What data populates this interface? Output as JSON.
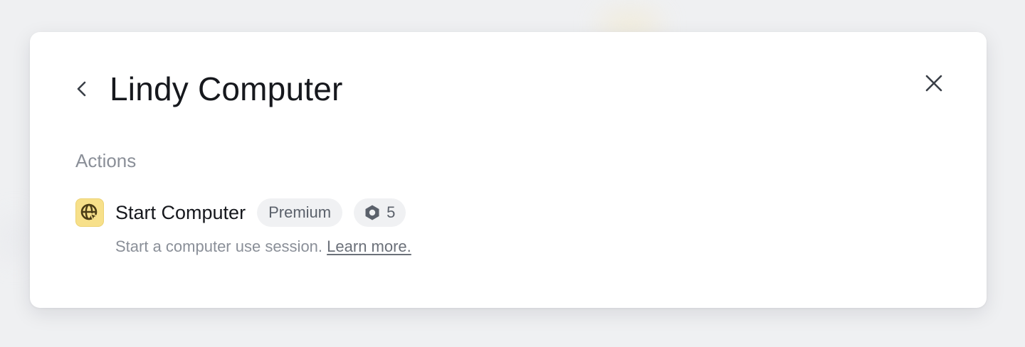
{
  "modal": {
    "title": "Lindy Computer",
    "back_icon": "chevron-left-icon",
    "close_icon": "close-icon"
  },
  "actions_section": {
    "label": "Actions",
    "items": [
      {
        "icon": "globe-cursor-icon",
        "name": "Start Computer",
        "badge": "Premium",
        "credit_icon": "hexagon-credit-icon",
        "credits": "5",
        "description": "Start a computer use session.",
        "link_text": "Learn more."
      }
    ]
  },
  "colors": {
    "icon_bg": "#f7e08a",
    "pill_bg": "#f0f1f3",
    "page_bg": "#eff0f2"
  }
}
